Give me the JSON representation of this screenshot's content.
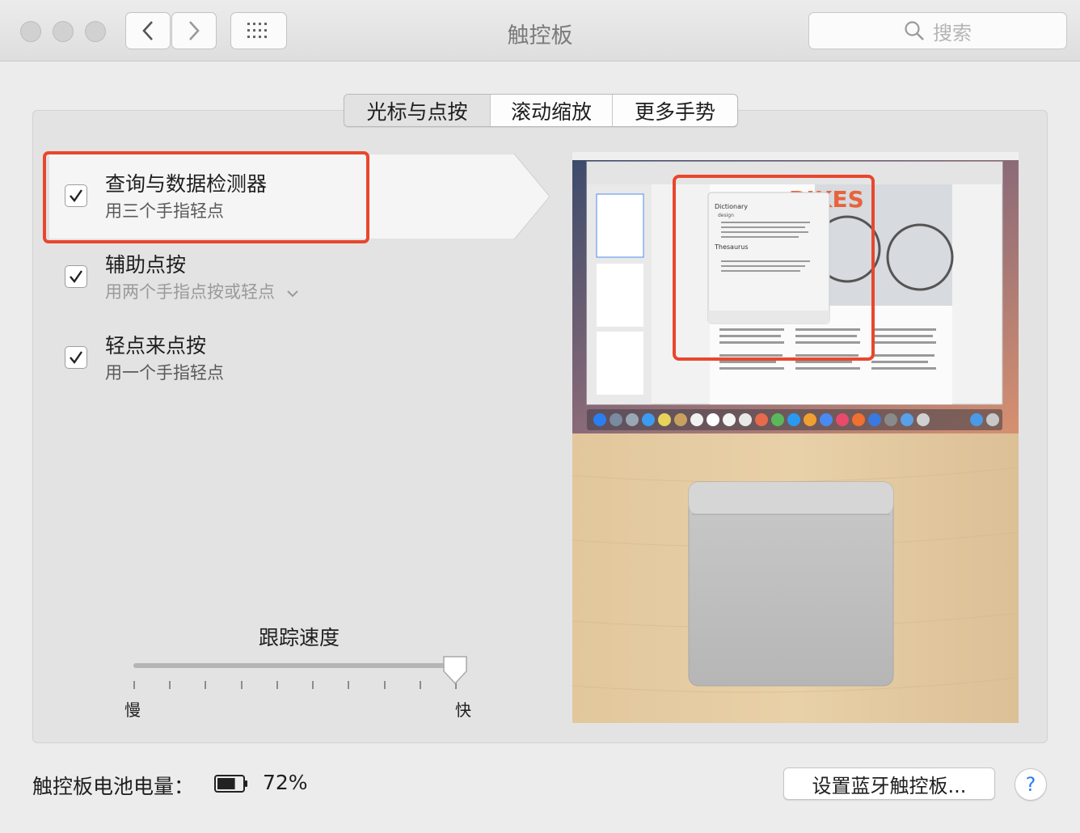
{
  "window": {
    "title": "触控板",
    "search_placeholder": "搜索"
  },
  "tabs": [
    {
      "label": "光标与点按",
      "active": true
    },
    {
      "label": "滚动缩放",
      "active": false
    },
    {
      "label": "更多手势",
      "active": false
    }
  ],
  "options": [
    {
      "title": "查询与数据检测器",
      "subtitle": "用三个手指轻点",
      "checked": true,
      "selected": true
    },
    {
      "title": "辅助点按",
      "subtitle": "用两个手指点按或轻点",
      "checked": true,
      "has_dropdown": true
    },
    {
      "title": "轻点来点按",
      "subtitle": "用一个手指轻点",
      "checked": true
    }
  ],
  "tracking_speed": {
    "label": "跟踪速度",
    "min_label": "慢",
    "max_label": "快",
    "value_fraction": 1.0,
    "ticks": 10
  },
  "preview": {
    "dictionary_title": "Dictionary",
    "dictionary_word": "design",
    "thesaurus_title": "Thesaurus",
    "poster_word": "BIKES"
  },
  "footer": {
    "battery_label": "触控板电池电量：",
    "battery_percent": "72%",
    "battery_level": 0.72,
    "bluetooth_button": "设置蓝牙触控板...",
    "help_label": "?"
  },
  "colors": {
    "highlight": "#e8472d",
    "accent_blue": "#2a7ef0"
  }
}
